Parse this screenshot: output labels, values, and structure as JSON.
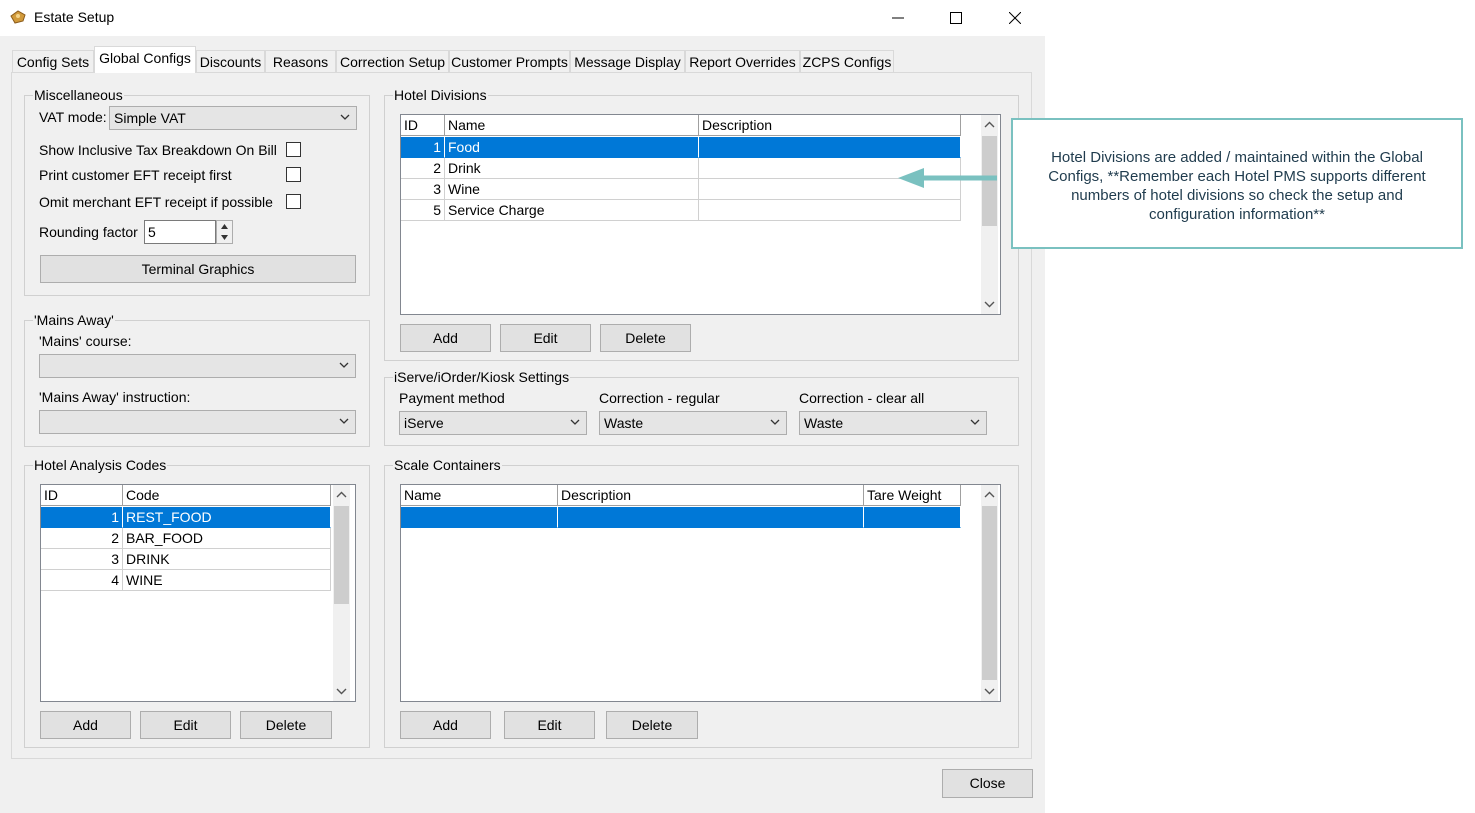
{
  "window": {
    "title": "Estate Setup",
    "icon": "app-icon",
    "controls": {
      "minimize": "minimize-icon",
      "maximize": "maximize-icon",
      "close": "close-icon"
    }
  },
  "tabs": [
    {
      "label": "Config Sets"
    },
    {
      "label": "Global Configs",
      "active": true
    },
    {
      "label": "Discounts"
    },
    {
      "label": "Reasons"
    },
    {
      "label": "Correction Setup"
    },
    {
      "label": "Customer Prompts"
    },
    {
      "label": "Message Display"
    },
    {
      "label": "Report Overrides"
    },
    {
      "label": "ZCPS Configs"
    }
  ],
  "misc": {
    "legend": "Miscellaneous",
    "vat_label": "VAT mode:",
    "vat_value": "Simple VAT",
    "inclusive_tax_label": "Show Inclusive Tax Breakdown On Bill",
    "inclusive_tax_checked": false,
    "print_eft_label": "Print customer EFT receipt first",
    "print_eft_checked": false,
    "omit_eft_label": "Omit merchant EFT receipt if possible",
    "omit_eft_checked": false,
    "rounding_label": "Rounding factor",
    "rounding_value": "5",
    "terminal_graphics": "Terminal Graphics"
  },
  "mains_away": {
    "legend": "'Mains Away'",
    "course_label": "'Mains' course:",
    "course_value": "",
    "instruction_label": "'Mains Away' instruction:",
    "instruction_value": ""
  },
  "hotel_analysis": {
    "legend": "Hotel Analysis Codes",
    "columns": [
      "ID",
      "Code"
    ],
    "rows": [
      {
        "id": "1",
        "code": "REST_FOOD",
        "selected": true
      },
      {
        "id": "2",
        "code": "BAR_FOOD"
      },
      {
        "id": "3",
        "code": "DRINK"
      },
      {
        "id": "4",
        "code": "WINE"
      }
    ],
    "add": "Add",
    "edit": "Edit",
    "delete": "Delete"
  },
  "hotel_divisions": {
    "legend": "Hotel Divisions",
    "columns": [
      "ID",
      "Name",
      "Description"
    ],
    "rows": [
      {
        "id": "1",
        "name": "Food",
        "description": "",
        "selected": true
      },
      {
        "id": "2",
        "name": "Drink",
        "description": ""
      },
      {
        "id": "3",
        "name": "Wine",
        "description": ""
      },
      {
        "id": "5",
        "name": "Service Charge",
        "description": ""
      }
    ],
    "add": "Add",
    "edit": "Edit",
    "delete": "Delete"
  },
  "iserve": {
    "legend": "iServe/iOrder/Kiosk Settings",
    "payment_label": "Payment method",
    "payment_value": "iServe",
    "correction_regular_label": "Correction  - regular",
    "correction_regular_value": "Waste",
    "correction_clear_label": "Correction - clear all",
    "correction_clear_value": "Waste"
  },
  "scale_containers": {
    "legend": "Scale Containers",
    "columns": [
      "Name",
      "Description",
      "Tare Weight"
    ],
    "rows": [
      {
        "name": "",
        "description": "",
        "tare": "",
        "selected": true
      }
    ],
    "add": "Add",
    "edit": "Edit",
    "delete": "Delete"
  },
  "footer": {
    "close": "Close"
  },
  "callout": {
    "text": "Hotel Divisions are added / maintained within the Global Configs, **Remember each Hotel PMS supports different numbers of hotel divisions so check the setup and configuration information**",
    "border_color": "#7ac1c0",
    "arrow_color": "#7ac1c0"
  },
  "colors": {
    "selection": "#0078d7",
    "window_bg": "#f0f0f0"
  }
}
